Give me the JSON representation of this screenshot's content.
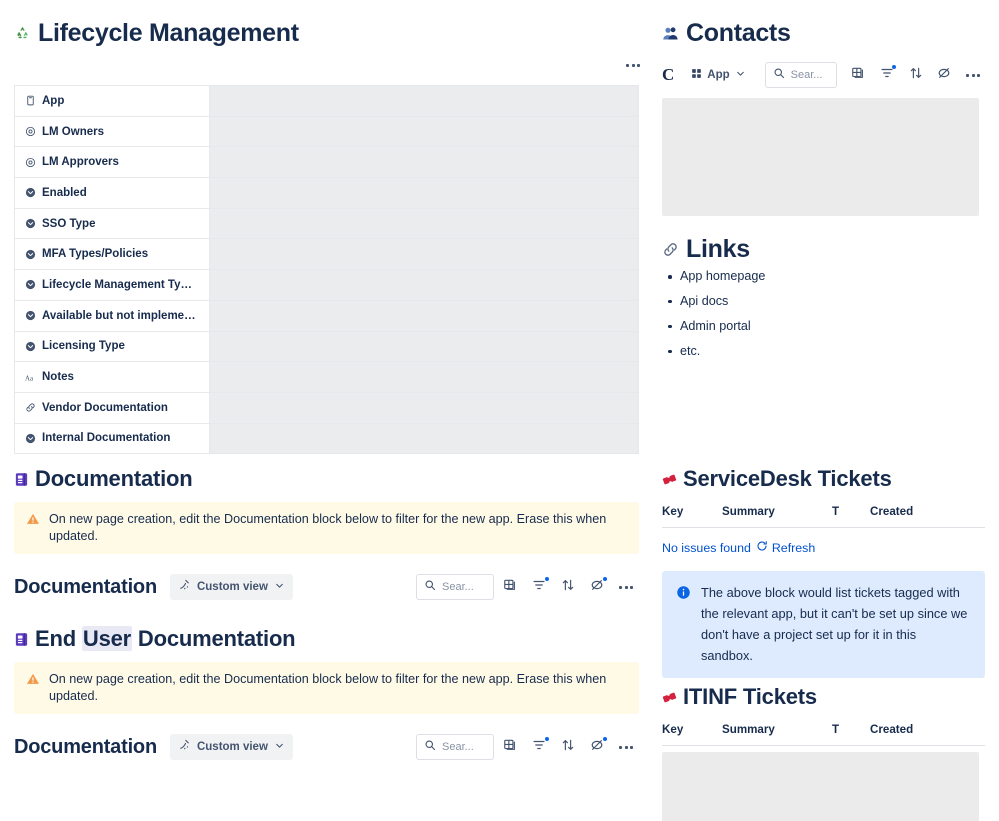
{
  "page": {
    "title": "Lifecycle Management",
    "title_emoji": "recycle-symbol"
  },
  "properties": {
    "rows": [
      {
        "label": "App",
        "icon": "mobile-app-icon"
      },
      {
        "label": "LM Owners",
        "icon": "user-mention-icon"
      },
      {
        "label": "LM Approvers",
        "icon": "user-mention-icon"
      },
      {
        "label": "Enabled",
        "icon": "select-dropdown-icon"
      },
      {
        "label": "SSO Type",
        "icon": "select-dropdown-icon"
      },
      {
        "label": "MFA Types/Policies",
        "icon": "select-dropdown-icon"
      },
      {
        "label": "Lifecycle Management Ty…",
        "icon": "select-dropdown-icon"
      },
      {
        "label": "Available but not impleme…",
        "icon": "select-dropdown-icon"
      },
      {
        "label": "Licensing Type",
        "icon": "select-dropdown-icon"
      },
      {
        "label": "Notes",
        "icon": "text-format-icon"
      },
      {
        "label": "Vendor Documentation",
        "icon": "link-icon"
      },
      {
        "label": "Internal Documentation",
        "icon": "select-dropdown-icon"
      }
    ]
  },
  "documentation_section": {
    "heading": "Documentation",
    "heading_emoji": "notebook-icon",
    "banner": "On new page creation, edit the Documentation block below to filter for the new app. Erase this when updated.",
    "block": {
      "title": "Documentation",
      "view_label": "Custom view",
      "search_placeholder": "Sear...",
      "tools": [
        {
          "name": "table-view-icon",
          "badge": false
        },
        {
          "name": "filter-icon",
          "badge": true
        },
        {
          "name": "sort-icon",
          "badge": false
        },
        {
          "name": "hide-fields-icon",
          "badge": true
        },
        {
          "name": "more-options-icon",
          "badge": false
        }
      ]
    }
  },
  "end_user_documentation_section": {
    "heading_part1": "End ",
    "heading_highlight": "User",
    "heading_part2": " Documentation",
    "heading_emoji": "notebook-icon",
    "banner": "On new page creation, edit the Documentation block below to filter for the new app. Erase this when updated.",
    "block": {
      "title": "Documentation",
      "view_label": "Custom view",
      "search_placeholder": "Sear...",
      "tools": [
        {
          "name": "table-view-icon",
          "badge": false
        },
        {
          "name": "filter-icon",
          "badge": true
        },
        {
          "name": "sort-icon",
          "badge": false
        },
        {
          "name": "hide-fields-icon",
          "badge": true
        },
        {
          "name": "more-options-icon",
          "badge": false
        }
      ]
    }
  },
  "contacts": {
    "heading": "Contacts",
    "heading_emoji": "busts-in-silhouette-icon",
    "logo_letter": "C",
    "app_chip_label": "App",
    "search_placeholder": "Sear...",
    "tools": [
      {
        "name": "table-view-icon",
        "badge": false
      },
      {
        "name": "filter-icon",
        "badge": true
      },
      {
        "name": "sort-icon",
        "badge": false
      },
      {
        "name": "hide-fields-icon",
        "badge": false
      },
      {
        "name": "more-options-icon",
        "badge": false
      }
    ]
  },
  "links": {
    "heading": "Links",
    "heading_emoji": "link-icon",
    "items": [
      "App homepage",
      "Api docs",
      "Admin portal",
      "etc."
    ]
  },
  "servicedesk_tickets": {
    "heading": "ServiceDesk Tickets",
    "heading_emoji": "ticket-icon",
    "columns": [
      "Key",
      "Summary",
      "T",
      "Created"
    ],
    "empty_text": "No issues found",
    "refresh_label": "Refresh",
    "info_text": "The above block would list tickets tagged with the relevant app, but it can't be set up since we don't have a project set up for it in this sandbox."
  },
  "itinf_tickets": {
    "heading": "ITINF Tickets",
    "heading_emoji": "ticket-icon",
    "columns": [
      "Key",
      "Summary",
      "T",
      "Created"
    ]
  },
  "colors": {
    "heading": "#172b4d",
    "link": "#0052cc",
    "accent_blue": "#0c66e4",
    "warning_bg": "#fffae6",
    "warning_icon": "#f2994a",
    "info_bg": "#deebff",
    "placeholder_grey": "#ebebeb",
    "ticket_red": "#d4213d",
    "notebook_purple": "#5c3bbd"
  }
}
